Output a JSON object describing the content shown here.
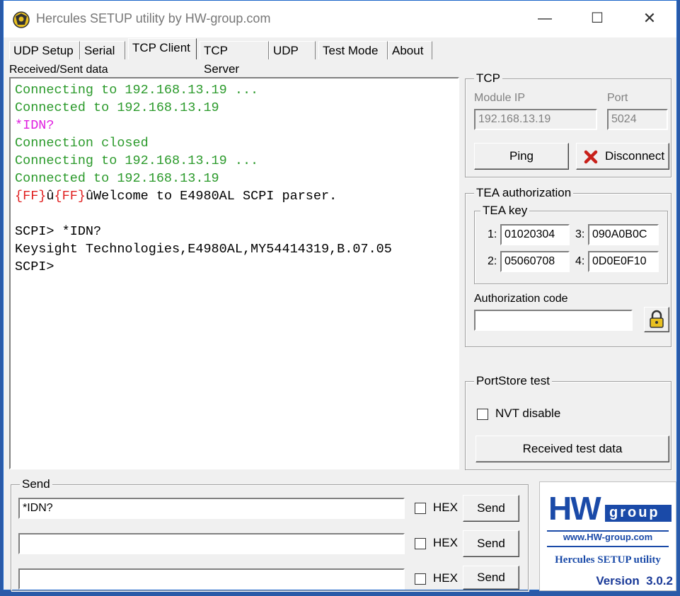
{
  "window": {
    "title": "Hercules SETUP utility by HW-group.com",
    "minimize": "—",
    "maximize": "☐",
    "close": "✕"
  },
  "tabs": [
    {
      "label": "UDP Setup"
    },
    {
      "label": "Serial"
    },
    {
      "label": "TCP Client",
      "active": true
    },
    {
      "label": "TCP Server"
    },
    {
      "label": "UDP"
    },
    {
      "label": "Test Mode"
    },
    {
      "label": "About"
    }
  ],
  "received": {
    "label": "Received/Sent data",
    "lines": [
      {
        "segments": [
          {
            "text": "Connecting to 192.168.13.19 ...",
            "color": "green"
          }
        ]
      },
      {
        "segments": [
          {
            "text": "Connected to 192.168.13.19",
            "color": "green"
          }
        ]
      },
      {
        "segments": [
          {
            "text": "*IDN?",
            "color": "magenta"
          }
        ]
      },
      {
        "segments": [
          {
            "text": "Connection closed",
            "color": "green"
          }
        ]
      },
      {
        "segments": [
          {
            "text": "Connecting to 192.168.13.19 ...",
            "color": "green"
          }
        ]
      },
      {
        "segments": [
          {
            "text": "Connected to 192.168.13.19",
            "color": "green"
          }
        ]
      },
      {
        "segments": [
          {
            "text": "{FF}",
            "color": "red"
          },
          {
            "text": "û",
            "color": "black"
          },
          {
            "text": "{FF}",
            "color": "red"
          },
          {
            "text": "ûWelcome to E4980AL SCPI parser.",
            "color": "black"
          }
        ]
      },
      {
        "segments": [
          {
            "text": "",
            "color": "black"
          }
        ]
      },
      {
        "segments": [
          {
            "text": "SCPI> *IDN?",
            "color": "black"
          }
        ]
      },
      {
        "segments": [
          {
            "text": "Keysight Technologies,E4980AL,MY54414319,B.07.05",
            "color": "black"
          }
        ]
      },
      {
        "segments": [
          {
            "text": "SCPI>",
            "color": "black"
          }
        ]
      }
    ]
  },
  "tcp": {
    "title": "TCP",
    "module_ip_label": "Module IP",
    "module_ip": "192.168.13.19",
    "port_label": "Port",
    "port": "5024",
    "ping_label": "Ping",
    "disconnect_label": "Disconnect"
  },
  "tea": {
    "title": "TEA authorization",
    "key_title": "TEA key",
    "keys": [
      {
        "label": "1:",
        "value": "01020304"
      },
      {
        "label": "3:",
        "value": "090A0B0C"
      },
      {
        "label": "2:",
        "value": "05060708"
      },
      {
        "label": "4:",
        "value": "0D0E0F10"
      }
    ],
    "auth_label": "Authorization code",
    "auth_value": ""
  },
  "portstore": {
    "title": "PortStore test",
    "nvt_label": "NVT disable",
    "nvt_checked": false,
    "received_test_label": "Received test data"
  },
  "send": {
    "title": "Send",
    "rows": [
      {
        "value": "*IDN?",
        "hex_label": "HEX",
        "button": "Send"
      },
      {
        "value": "",
        "hex_label": "HEX",
        "button": "Send"
      },
      {
        "value": "",
        "hex_label": "HEX",
        "button": "Send"
      }
    ]
  },
  "logo": {
    "hw": "HW",
    "group": "group",
    "url": "www.HW-group.com",
    "product": "Hercules SETUP utility",
    "version": "Version  3.0.2"
  },
  "colors": {
    "green": "#2b9a2b",
    "magenta": "#e020e0",
    "red": "#e02020",
    "black": "#000000",
    "logo_blue": "#1a4aa8"
  }
}
